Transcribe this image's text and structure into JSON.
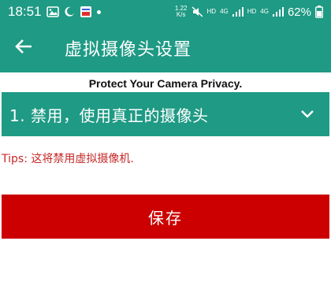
{
  "status_bar": {
    "time": "18:51",
    "speed_value": "1.22",
    "speed_unit": "K/s",
    "hd1": "HD",
    "net1": "4G",
    "hd2": "HD",
    "net2": "4G",
    "battery": "62%"
  },
  "app_bar": {
    "title": "虚拟摄像头设置",
    "background": "#1f9a84"
  },
  "main": {
    "privacy_text": "Protect Your Camera Privacy.",
    "select_value": "1. 禁用，使用真正的摄像头",
    "tips": "Tips: 这将禁用虚拟摄像机.",
    "save_label": "保存",
    "save_color": "#cc0000",
    "tips_color": "#c62828"
  }
}
